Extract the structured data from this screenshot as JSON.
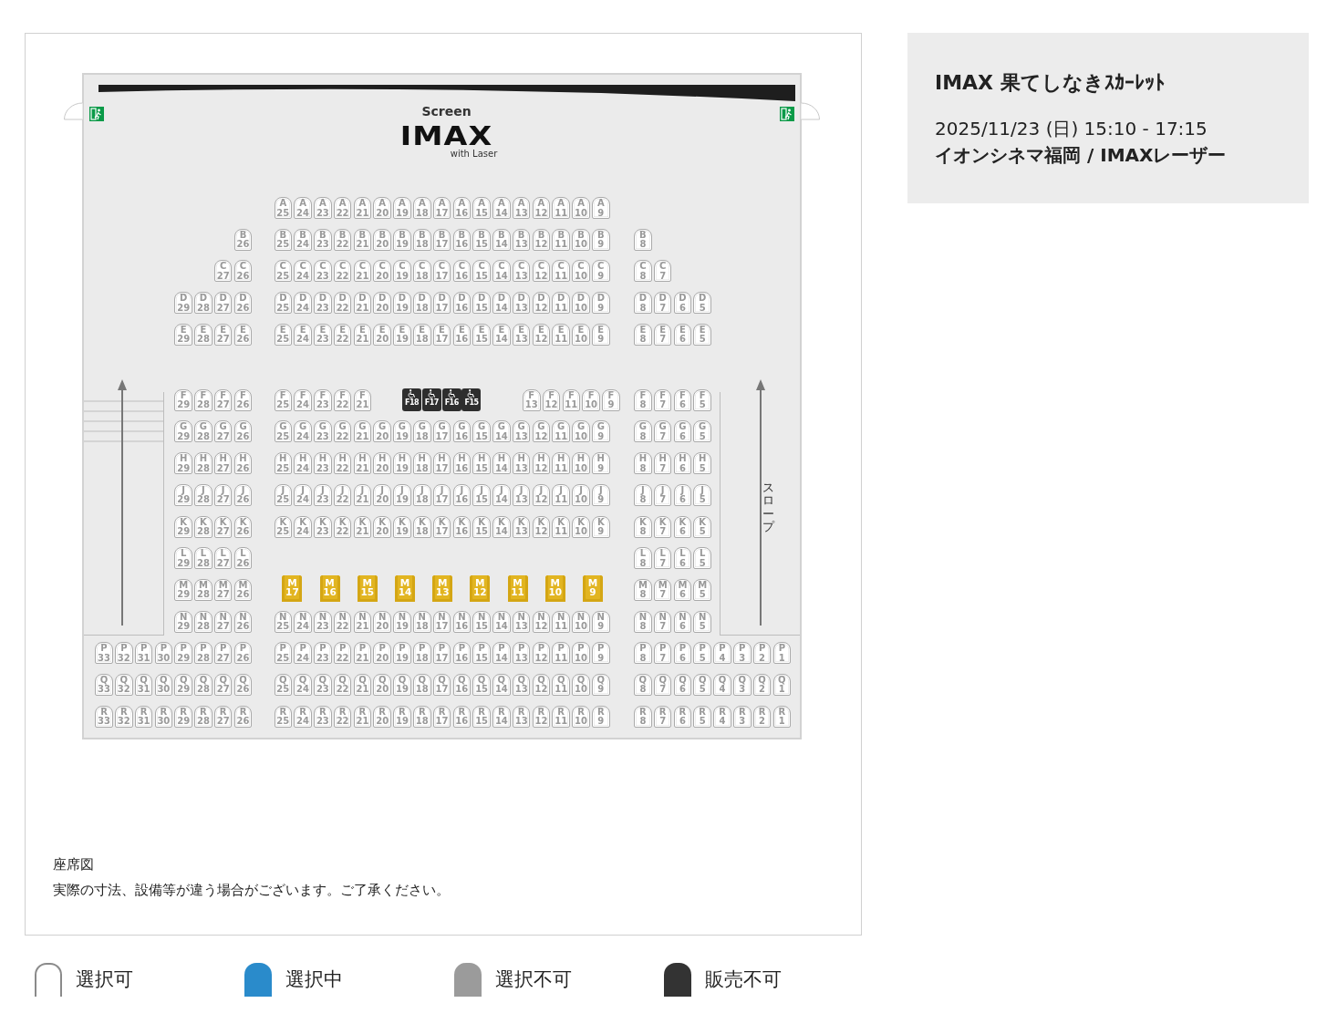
{
  "hall": {
    "screen_label": "Screen",
    "logo": {
      "text": "IMAX",
      "subtext": "with Laser"
    },
    "slope_label": "スロープ",
    "groups": [
      {
        "rows": [
          {
            "center": {
              "kind": "standard",
              "seats": [
                [
                  "A",
                  "25"
                ],
                [
                  "A",
                  "24"
                ],
                [
                  "A",
                  "23"
                ],
                [
                  "A",
                  "22"
                ],
                [
                  "A",
                  "21"
                ],
                [
                  "A",
                  "20"
                ],
                [
                  "A",
                  "19"
                ],
                [
                  "A",
                  "18"
                ],
                [
                  "A",
                  "17"
                ],
                [
                  "A",
                  "16"
                ],
                [
                  "A",
                  "15"
                ],
                [
                  "A",
                  "14"
                ],
                [
                  "A",
                  "13"
                ],
                [
                  "A",
                  "12"
                ],
                [
                  "A",
                  "11"
                ],
                [
                  "A",
                  "10"
                ],
                [
                  "A",
                  "9"
                ]
              ]
            }
          },
          {
            "left": {
              "kind": "standard",
              "seats": [
                [
                  "B",
                  "26"
                ]
              ]
            },
            "center": {
              "kind": "standard",
              "seats": [
                [
                  "B",
                  "25"
                ],
                [
                  "B",
                  "24"
                ],
                [
                  "B",
                  "23"
                ],
                [
                  "B",
                  "22"
                ],
                [
                  "B",
                  "21"
                ],
                [
                  "B",
                  "20"
                ],
                [
                  "B",
                  "19"
                ],
                [
                  "B",
                  "18"
                ],
                [
                  "B",
                  "17"
                ],
                [
                  "B",
                  "16"
                ],
                [
                  "B",
                  "15"
                ],
                [
                  "B",
                  "14"
                ],
                [
                  "B",
                  "13"
                ],
                [
                  "B",
                  "12"
                ],
                [
                  "B",
                  "11"
                ],
                [
                  "B",
                  "10"
                ],
                [
                  "B",
                  "9"
                ]
              ]
            },
            "right": {
              "kind": "standard",
              "seats": [
                [
                  "B",
                  "8"
                ]
              ]
            }
          },
          {
            "left": {
              "kind": "standard",
              "seats": [
                [
                  "C",
                  "27"
                ],
                [
                  "C",
                  "26"
                ]
              ]
            },
            "center": {
              "kind": "standard",
              "seats": [
                [
                  "C",
                  "25"
                ],
                [
                  "C",
                  "24"
                ],
                [
                  "C",
                  "23"
                ],
                [
                  "C",
                  "22"
                ],
                [
                  "C",
                  "21"
                ],
                [
                  "C",
                  "20"
                ],
                [
                  "C",
                  "19"
                ],
                [
                  "C",
                  "18"
                ],
                [
                  "C",
                  "17"
                ],
                [
                  "C",
                  "16"
                ],
                [
                  "C",
                  "15"
                ],
                [
                  "C",
                  "14"
                ],
                [
                  "C",
                  "13"
                ],
                [
                  "C",
                  "12"
                ],
                [
                  "C",
                  "11"
                ],
                [
                  "C",
                  "10"
                ],
                [
                  "C",
                  "9"
                ]
              ]
            },
            "right": {
              "kind": "standard",
              "seats": [
                [
                  "C",
                  "8"
                ],
                [
                  "C",
                  "7"
                ]
              ]
            }
          },
          {
            "left": {
              "kind": "standard",
              "seats": [
                [
                  "D",
                  "29"
                ],
                [
                  "D",
                  "28"
                ],
                [
                  "D",
                  "27"
                ],
                [
                  "D",
                  "26"
                ]
              ]
            },
            "center": {
              "kind": "standard",
              "seats": [
                [
                  "D",
                  "25"
                ],
                [
                  "D",
                  "24"
                ],
                [
                  "D",
                  "23"
                ],
                [
                  "D",
                  "22"
                ],
                [
                  "D",
                  "21"
                ],
                [
                  "D",
                  "20"
                ],
                [
                  "D",
                  "19"
                ],
                [
                  "D",
                  "18"
                ],
                [
                  "D",
                  "17"
                ],
                [
                  "D",
                  "16"
                ],
                [
                  "D",
                  "15"
                ],
                [
                  "D",
                  "14"
                ],
                [
                  "D",
                  "13"
                ],
                [
                  "D",
                  "12"
                ],
                [
                  "D",
                  "11"
                ],
                [
                  "D",
                  "10"
                ],
                [
                  "D",
                  "9"
                ]
              ]
            },
            "right": {
              "kind": "standard",
              "seats": [
                [
                  "D",
                  "8"
                ],
                [
                  "D",
                  "7"
                ],
                [
                  "D",
                  "6"
                ],
                [
                  "D",
                  "5"
                ]
              ]
            }
          },
          {
            "left": {
              "kind": "standard",
              "seats": [
                [
                  "E",
                  "29"
                ],
                [
                  "E",
                  "28"
                ],
                [
                  "E",
                  "27"
                ],
                [
                  "E",
                  "26"
                ]
              ]
            },
            "center": {
              "kind": "standard",
              "seats": [
                [
                  "E",
                  "25"
                ],
                [
                  "E",
                  "24"
                ],
                [
                  "E",
                  "23"
                ],
                [
                  "E",
                  "22"
                ],
                [
                  "E",
                  "21"
                ],
                [
                  "E",
                  "20"
                ],
                [
                  "E",
                  "19"
                ],
                [
                  "E",
                  "18"
                ],
                [
                  "E",
                  "17"
                ],
                [
                  "E",
                  "16"
                ],
                [
                  "E",
                  "15"
                ],
                [
                  "E",
                  "14"
                ],
                [
                  "E",
                  "13"
                ],
                [
                  "E",
                  "12"
                ],
                [
                  "E",
                  "11"
                ],
                [
                  "E",
                  "10"
                ],
                [
                  "E",
                  "9"
                ]
              ]
            },
            "right": {
              "kind": "standard",
              "seats": [
                [
                  "E",
                  "8"
                ],
                [
                  "E",
                  "7"
                ],
                [
                  "E",
                  "6"
                ],
                [
                  "E",
                  "5"
                ]
              ]
            }
          }
        ]
      },
      {
        "rows": [
          {
            "left": {
              "kind": "standard",
              "seats": [
                [
                  "F",
                  "29"
                ],
                [
                  "F",
                  "28"
                ],
                [
                  "F",
                  "27"
                ],
                [
                  "F",
                  "26"
                ]
              ]
            },
            "center": {
              "kind": "standard",
              "seats": [
                [
                  "F",
                  "25"
                ],
                [
                  "F",
                  "24"
                ],
                [
                  "F",
                  "23"
                ],
                [
                  "F",
                  "22"
                ],
                [
                  "F",
                  "21"
                ],
                {
                  "kind": "gap"
                },
                {
                  "kind": "wheelchair",
                  "label": "F18"
                },
                {
                  "kind": "wheelchair",
                  "label": "F17"
                },
                {
                  "kind": "wheelchair",
                  "label": "F16"
                },
                {
                  "kind": "wheelchair",
                  "label": "F15"
                },
                {
                  "kind": "gap"
                },
                {
                  "kind": "gap"
                },
                [
                  "F",
                  "13"
                ],
                [
                  "F",
                  "12"
                ],
                [
                  "F",
                  "11"
                ],
                [
                  "F",
                  "10"
                ],
                [
                  "F",
                  "9"
                ]
              ]
            },
            "right": {
              "kind": "standard",
              "seats": [
                [
                  "F",
                  "8"
                ],
                [
                  "F",
                  "7"
                ],
                [
                  "F",
                  "6"
                ],
                [
                  "F",
                  "5"
                ]
              ]
            }
          },
          {
            "left": {
              "kind": "standard",
              "seats": [
                [
                  "G",
                  "29"
                ],
                [
                  "G",
                  "28"
                ],
                [
                  "G",
                  "27"
                ],
                [
                  "G",
                  "26"
                ]
              ]
            },
            "center": {
              "kind": "standard",
              "seats": [
                [
                  "G",
                  "25"
                ],
                [
                  "G",
                  "24"
                ],
                [
                  "G",
                  "23"
                ],
                [
                  "G",
                  "22"
                ],
                [
                  "G",
                  "21"
                ],
                [
                  "G",
                  "20"
                ],
                [
                  "G",
                  "19"
                ],
                [
                  "G",
                  "18"
                ],
                [
                  "G",
                  "17"
                ],
                [
                  "G",
                  "16"
                ],
                [
                  "G",
                  "15"
                ],
                [
                  "G",
                  "14"
                ],
                [
                  "G",
                  "13"
                ],
                [
                  "G",
                  "12"
                ],
                [
                  "G",
                  "11"
                ],
                [
                  "G",
                  "10"
                ],
                [
                  "G",
                  "9"
                ]
              ]
            },
            "right": {
              "kind": "standard",
              "seats": [
                [
                  "G",
                  "8"
                ],
                [
                  "G",
                  "7"
                ],
                [
                  "G",
                  "6"
                ],
                [
                  "G",
                  "5"
                ]
              ]
            }
          },
          {
            "left": {
              "kind": "standard",
              "seats": [
                [
                  "H",
                  "29"
                ],
                [
                  "H",
                  "28"
                ],
                [
                  "H",
                  "27"
                ],
                [
                  "H",
                  "26"
                ]
              ]
            },
            "center": {
              "kind": "standard",
              "seats": [
                [
                  "H",
                  "25"
                ],
                [
                  "H",
                  "24"
                ],
                [
                  "H",
                  "23"
                ],
                [
                  "H",
                  "22"
                ],
                [
                  "H",
                  "21"
                ],
                [
                  "H",
                  "20"
                ],
                [
                  "H",
                  "19"
                ],
                [
                  "H",
                  "18"
                ],
                [
                  "H",
                  "17"
                ],
                [
                  "H",
                  "16"
                ],
                [
                  "H",
                  "15"
                ],
                [
                  "H",
                  "14"
                ],
                [
                  "H",
                  "13"
                ],
                [
                  "H",
                  "12"
                ],
                [
                  "H",
                  "11"
                ],
                [
                  "H",
                  "10"
                ],
                [
                  "H",
                  "9"
                ]
              ]
            },
            "right": {
              "kind": "standard",
              "seats": [
                [
                  "H",
                  "8"
                ],
                [
                  "H",
                  "7"
                ],
                [
                  "H",
                  "6"
                ],
                [
                  "H",
                  "5"
                ]
              ]
            }
          },
          {
            "left": {
              "kind": "standard",
              "seats": [
                [
                  "J",
                  "29"
                ],
                [
                  "J",
                  "28"
                ],
                [
                  "J",
                  "27"
                ],
                [
                  "J",
                  "26"
                ]
              ]
            },
            "center": {
              "kind": "standard",
              "seats": [
                [
                  "J",
                  "25"
                ],
                [
                  "J",
                  "24"
                ],
                [
                  "J",
                  "23"
                ],
                [
                  "J",
                  "22"
                ],
                [
                  "J",
                  "21"
                ],
                [
                  "J",
                  "20"
                ],
                [
                  "J",
                  "19"
                ],
                [
                  "J",
                  "18"
                ],
                [
                  "J",
                  "17"
                ],
                [
                  "J",
                  "16"
                ],
                [
                  "J",
                  "15"
                ],
                [
                  "J",
                  "14"
                ],
                [
                  "J",
                  "13"
                ],
                [
                  "J",
                  "12"
                ],
                [
                  "J",
                  "11"
                ],
                [
                  "J",
                  "10"
                ],
                [
                  "J",
                  "9"
                ]
              ]
            },
            "right": {
              "kind": "standard",
              "seats": [
                [
                  "J",
                  "8"
                ],
                [
                  "J",
                  "7"
                ],
                [
                  "J",
                  "6"
                ],
                [
                  "J",
                  "5"
                ]
              ]
            }
          },
          {
            "left": {
              "kind": "standard",
              "seats": [
                [
                  "K",
                  "29"
                ],
                [
                  "K",
                  "28"
                ],
                [
                  "K",
                  "27"
                ],
                [
                  "K",
                  "26"
                ]
              ]
            },
            "center": {
              "kind": "standard",
              "seats": [
                [
                  "K",
                  "25"
                ],
                [
                  "K",
                  "24"
                ],
                [
                  "K",
                  "23"
                ],
                [
                  "K",
                  "22"
                ],
                [
                  "K",
                  "21"
                ],
                [
                  "K",
                  "20"
                ],
                [
                  "K",
                  "19"
                ],
                [
                  "K",
                  "18"
                ],
                [
                  "K",
                  "17"
                ],
                [
                  "K",
                  "16"
                ],
                [
                  "K",
                  "15"
                ],
                [
                  "K",
                  "14"
                ],
                [
                  "K",
                  "13"
                ],
                [
                  "K",
                  "12"
                ],
                [
                  "K",
                  "11"
                ],
                [
                  "K",
                  "10"
                ],
                [
                  "K",
                  "9"
                ]
              ]
            },
            "right": {
              "kind": "standard",
              "seats": [
                [
                  "K",
                  "8"
                ],
                [
                  "K",
                  "7"
                ],
                [
                  "K",
                  "6"
                ],
                [
                  "K",
                  "5"
                ]
              ]
            }
          },
          {
            "left": {
              "kind": "standard",
              "seats": [
                [
                  "L",
                  "29"
                ],
                [
                  "L",
                  "28"
                ],
                [
                  "L",
                  "27"
                ],
                [
                  "L",
                  "26"
                ]
              ]
            },
            "right": {
              "kind": "standard",
              "seats": [
                [
                  "L",
                  "8"
                ],
                [
                  "L",
                  "7"
                ],
                [
                  "L",
                  "6"
                ],
                [
                  "L",
                  "5"
                ]
              ]
            }
          },
          {
            "left": {
              "kind": "standard",
              "seats": [
                [
                  "M",
                  "29"
                ],
                [
                  "M",
                  "28"
                ],
                [
                  "M",
                  "27"
                ],
                [
                  "M",
                  "26"
                ]
              ]
            },
            "center": {
              "kind": "premium",
              "seats": [
                [
                  "M",
                  "17"
                ],
                [
                  "M",
                  "16"
                ],
                [
                  "M",
                  "15"
                ],
                [
                  "M",
                  "14"
                ],
                [
                  "M",
                  "13"
                ],
                [
                  "M",
                  "12"
                ],
                [
                  "M",
                  "11"
                ],
                [
                  "M",
                  "10"
                ],
                [
                  "M",
                  "9"
                ]
              ]
            },
            "right": {
              "kind": "standard",
              "seats": [
                [
                  "M",
                  "8"
                ],
                [
                  "M",
                  "7"
                ],
                [
                  "M",
                  "6"
                ],
                [
                  "M",
                  "5"
                ]
              ]
            }
          },
          {
            "left": {
              "kind": "standard",
              "seats": [
                [
                  "N",
                  "29"
                ],
                [
                  "N",
                  "28"
                ],
                [
                  "N",
                  "27"
                ],
                [
                  "N",
                  "26"
                ]
              ]
            },
            "center": {
              "kind": "standard",
              "seats": [
                [
                  "N",
                  "25"
                ],
                [
                  "N",
                  "24"
                ],
                [
                  "N",
                  "23"
                ],
                [
                  "N",
                  "22"
                ],
                [
                  "N",
                  "21"
                ],
                [
                  "N",
                  "20"
                ],
                [
                  "N",
                  "19"
                ],
                [
                  "N",
                  "18"
                ],
                [
                  "N",
                  "17"
                ],
                [
                  "N",
                  "16"
                ],
                [
                  "N",
                  "15"
                ],
                [
                  "N",
                  "14"
                ],
                [
                  "N",
                  "13"
                ],
                [
                  "N",
                  "12"
                ],
                [
                  "N",
                  "11"
                ],
                [
                  "N",
                  "10"
                ],
                [
                  "N",
                  "9"
                ]
              ]
            },
            "right": {
              "kind": "standard",
              "seats": [
                [
                  "N",
                  "8"
                ],
                [
                  "N",
                  "7"
                ],
                [
                  "N",
                  "6"
                ],
                [
                  "N",
                  "5"
                ]
              ]
            }
          },
          {
            "left": {
              "kind": "standard",
              "seats": [
                [
                  "P",
                  "33"
                ],
                [
                  "P",
                  "32"
                ],
                [
                  "P",
                  "31"
                ],
                [
                  "P",
                  "30"
                ],
                [
                  "P",
                  "29"
                ],
                [
                  "P",
                  "28"
                ],
                [
                  "P",
                  "27"
                ],
                [
                  "P",
                  "26"
                ]
              ]
            },
            "center": {
              "kind": "standard",
              "seats": [
                [
                  "P",
                  "25"
                ],
                [
                  "P",
                  "24"
                ],
                [
                  "P",
                  "23"
                ],
                [
                  "P",
                  "22"
                ],
                [
                  "P",
                  "21"
                ],
                [
                  "P",
                  "20"
                ],
                [
                  "P",
                  "19"
                ],
                [
                  "P",
                  "18"
                ],
                [
                  "P",
                  "17"
                ],
                [
                  "P",
                  "16"
                ],
                [
                  "P",
                  "15"
                ],
                [
                  "P",
                  "14"
                ],
                [
                  "P",
                  "13"
                ],
                [
                  "P",
                  "12"
                ],
                [
                  "P",
                  "11"
                ],
                [
                  "P",
                  "10"
                ],
                [
                  "P",
                  "9"
                ]
              ]
            },
            "right": {
              "kind": "standard",
              "seats": [
                [
                  "P",
                  "8"
                ],
                [
                  "P",
                  "7"
                ],
                [
                  "P",
                  "6"
                ],
                [
                  "P",
                  "5"
                ],
                [
                  "P",
                  "4"
                ],
                [
                  "P",
                  "3"
                ],
                [
                  "P",
                  "2"
                ],
                [
                  "P",
                  "1"
                ]
              ]
            }
          },
          {
            "left": {
              "kind": "standard",
              "seats": [
                [
                  "Q",
                  "33"
                ],
                [
                  "Q",
                  "32"
                ],
                [
                  "Q",
                  "31"
                ],
                [
                  "Q",
                  "30"
                ],
                [
                  "Q",
                  "29"
                ],
                [
                  "Q",
                  "28"
                ],
                [
                  "Q",
                  "27"
                ],
                [
                  "Q",
                  "26"
                ]
              ]
            },
            "center": {
              "kind": "standard",
              "seats": [
                [
                  "Q",
                  "25"
                ],
                [
                  "Q",
                  "24"
                ],
                [
                  "Q",
                  "23"
                ],
                [
                  "Q",
                  "22"
                ],
                [
                  "Q",
                  "21"
                ],
                [
                  "Q",
                  "20"
                ],
                [
                  "Q",
                  "19"
                ],
                [
                  "Q",
                  "18"
                ],
                [
                  "Q",
                  "17"
                ],
                [
                  "Q",
                  "16"
                ],
                [
                  "Q",
                  "15"
                ],
                [
                  "Q",
                  "14"
                ],
                [
                  "Q",
                  "13"
                ],
                [
                  "Q",
                  "12"
                ],
                [
                  "Q",
                  "11"
                ],
                [
                  "Q",
                  "10"
                ],
                [
                  "Q",
                  "9"
                ]
              ]
            },
            "right": {
              "kind": "standard",
              "seats": [
                [
                  "Q",
                  "8"
                ],
                [
                  "Q",
                  "7"
                ],
                [
                  "Q",
                  "6"
                ],
                [
                  "Q",
                  "5"
                ],
                [
                  "Q",
                  "4"
                ],
                [
                  "Q",
                  "3"
                ],
                [
                  "Q",
                  "2"
                ],
                [
                  "Q",
                  "1"
                ]
              ]
            }
          },
          {
            "left": {
              "kind": "standard",
              "seats": [
                [
                  "R",
                  "33"
                ],
                [
                  "R",
                  "32"
                ],
                [
                  "R",
                  "31"
                ],
                [
                  "R",
                  "30"
                ],
                [
                  "R",
                  "29"
                ],
                [
                  "R",
                  "28"
                ],
                [
                  "R",
                  "27"
                ],
                [
                  "R",
                  "26"
                ]
              ]
            },
            "center": {
              "kind": "standard",
              "seats": [
                [
                  "R",
                  "25"
                ],
                [
                  "R",
                  "24"
                ],
                [
                  "R",
                  "23"
                ],
                [
                  "R",
                  "22"
                ],
                [
                  "R",
                  "21"
                ],
                [
                  "R",
                  "20"
                ],
                [
                  "R",
                  "19"
                ],
                [
                  "R",
                  "18"
                ],
                [
                  "R",
                  "17"
                ],
                [
                  "R",
                  "16"
                ],
                [
                  "R",
                  "15"
                ],
                [
                  "R",
                  "14"
                ],
                [
                  "R",
                  "13"
                ],
                [
                  "R",
                  "12"
                ],
                [
                  "R",
                  "11"
                ],
                [
                  "R",
                  "10"
                ],
                [
                  "R",
                  "9"
                ]
              ]
            },
            "right": {
              "kind": "standard",
              "seats": [
                [
                  "R",
                  "8"
                ],
                [
                  "R",
                  "7"
                ],
                [
                  "R",
                  "6"
                ],
                [
                  "R",
                  "5"
                ],
                [
                  "R",
                  "4"
                ],
                [
                  "R",
                  "3"
                ],
                [
                  "R",
                  "2"
                ],
                [
                  "R",
                  "1"
                ]
              ]
            }
          }
        ]
      }
    ]
  },
  "caption": {
    "title": "座席図",
    "note": "実際の寸法、設備等が違う場合がございます。ご了承ください。"
  },
  "legend": [
    {
      "kind": "available",
      "label": "選択可"
    },
    {
      "kind": "selected",
      "label": "選択中"
    },
    {
      "kind": "unavailable",
      "label": "選択不可"
    },
    {
      "kind": "not_for_sale",
      "label": "販売不可"
    }
  ],
  "showing": {
    "title": "IMAX 果てしなきｽｶｰﾚｯﾄ",
    "datetime": "2025/11/23 (日) 15:10 - 17:15",
    "venue": "イオンシネマ福岡 / IMAXレーザー"
  }
}
